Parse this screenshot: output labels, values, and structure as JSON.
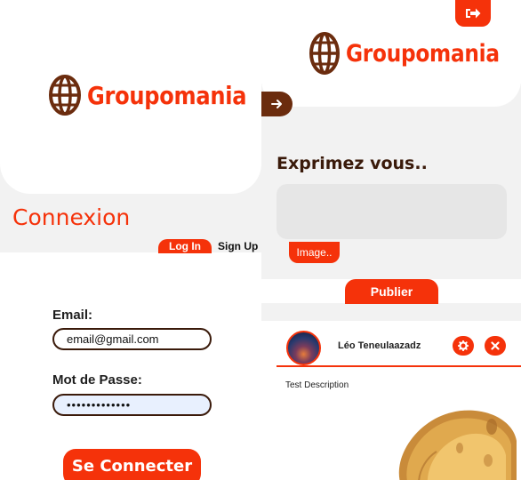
{
  "brand": {
    "name": "Groupomania",
    "color": "#f5320a",
    "globe_color": "#6b2c0e"
  },
  "login": {
    "title": "Connexion",
    "tabs": {
      "login": "Log In",
      "signup": "Sign Up"
    },
    "email_label": "Email:",
    "email_value": "email@gmail.com",
    "password_label": "Mot de Passe:",
    "password_value": "•••••••••••••",
    "submit_label": "Se Connecter"
  },
  "feed": {
    "compose_title": "Exprimez vous..",
    "image_button": "Image..",
    "publish_button": "Publier",
    "post": {
      "author": "Léo Teneulaazadz",
      "description": "Test Description"
    },
    "icons": {
      "logout": "logout-icon",
      "nav": "arrow-right-icon",
      "settings": "gear-icon",
      "delete": "close-icon"
    }
  }
}
